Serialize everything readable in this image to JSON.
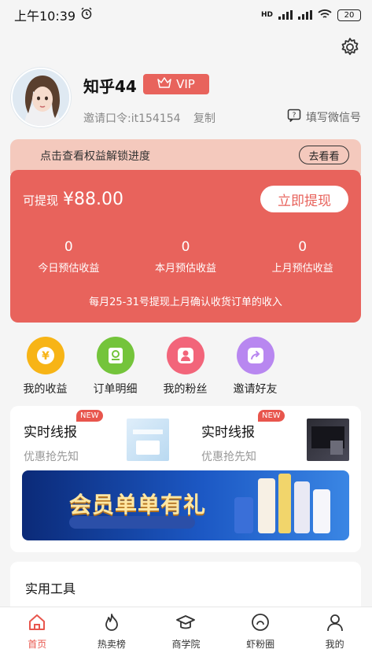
{
  "status_bar": {
    "time": "上午10:39",
    "network": "HD",
    "battery": "20"
  },
  "profile": {
    "nickname": "知乎44",
    "vip_label": "VIP",
    "invite_code": "邀请口令:it154154",
    "copy_label": "复制",
    "wechat_label": "填写微信号"
  },
  "unlock": {
    "text": "点击查看权益解锁进度",
    "button": "去看看"
  },
  "earnings": {
    "withdrawable_label": "可提现",
    "amount": "¥88.00",
    "withdraw_button": "立即提现",
    "stats": [
      {
        "value": "0",
        "label": "今日预估收益"
      },
      {
        "value": "0",
        "label": "本月预估收益"
      },
      {
        "value": "0",
        "label": "上月预估收益"
      }
    ],
    "note": "每月25-31号提现上月确认收货订单的收入"
  },
  "quick_menu": [
    {
      "label": "我的收益",
      "icon": "yen-coin-icon",
      "color": "#f7b416"
    },
    {
      "label": "订单明细",
      "icon": "order-detail-icon",
      "color": "#74c43b"
    },
    {
      "label": "我的粉丝",
      "icon": "fans-icon",
      "color": "#f2657a"
    },
    {
      "label": "邀请好友",
      "icon": "invite-share-icon",
      "color": "#b887f0"
    }
  ],
  "news": [
    {
      "title": "实时线报",
      "subtitle": "优惠抢先知",
      "badge": "NEW"
    },
    {
      "title": "实时线报",
      "subtitle": "优惠抢先知",
      "badge": "NEW"
    }
  ],
  "promo": {
    "text": "会员单单有礼"
  },
  "tools": {
    "title": "实用工具"
  },
  "tabs": [
    {
      "label": "首页",
      "icon": "home-icon",
      "active": true
    },
    {
      "label": "热卖榜",
      "icon": "flame-icon",
      "active": false
    },
    {
      "label": "商学院",
      "icon": "graduation-cap-icon",
      "active": false
    },
    {
      "label": "虾粉圈",
      "icon": "circle-icon",
      "active": false
    },
    {
      "label": "我的",
      "icon": "user-icon",
      "active": false
    }
  ],
  "colors": {
    "accent": "#e8635c",
    "banner": "#f4c9bd",
    "active_tab": "#e8564d"
  }
}
